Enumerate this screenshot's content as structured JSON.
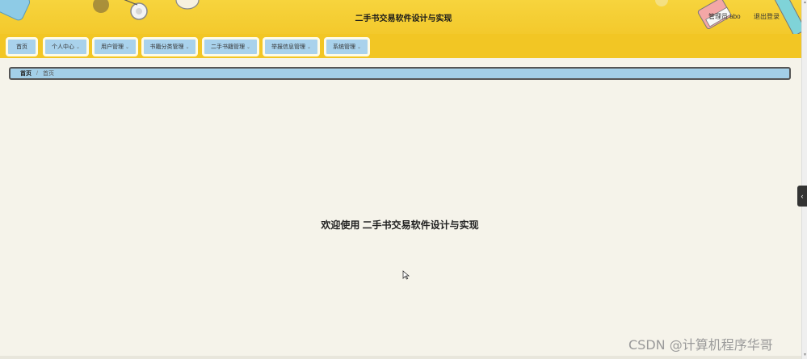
{
  "header": {
    "title": "二手书交易软件设计与实现",
    "admin_label": "管理员 abo",
    "logout_label": "退出登录"
  },
  "nav": {
    "items": [
      {
        "label": "首页",
        "has_dropdown": false
      },
      {
        "label": "个人中心",
        "has_dropdown": true
      },
      {
        "label": "用户管理",
        "has_dropdown": true
      },
      {
        "label": "书籍分类管理",
        "has_dropdown": true
      },
      {
        "label": "二手书籍管理",
        "has_dropdown": true
      },
      {
        "label": "举报信息管理",
        "has_dropdown": true
      },
      {
        "label": "系统管理",
        "has_dropdown": true
      }
    ],
    "chevron": "⌄"
  },
  "breadcrumb": {
    "home": "首页",
    "separator": "/",
    "current": "首页"
  },
  "main": {
    "welcome_text": "欢迎使用 二手书交易软件设计与实现"
  },
  "side_toggle": {
    "icon": "chevron-left-icon",
    "glyph": "‹"
  },
  "watermark": "CSDN @计算机程序华哥",
  "colors": {
    "header_yellow": "#f3c92c",
    "nav_item_blue": "#a9d2ec",
    "page_bg": "#f5f3ea"
  }
}
